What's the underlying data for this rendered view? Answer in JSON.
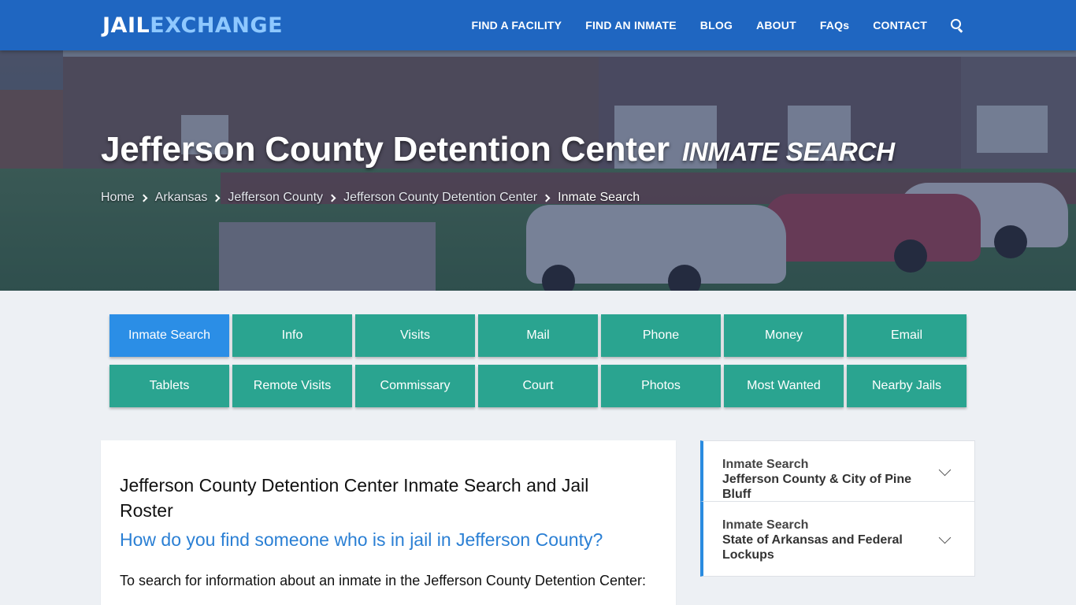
{
  "brand": {
    "logo_part1": "JAIL",
    "logo_part2": "EXCHANGE",
    "accent": "#1f66c1",
    "logo_accent": "#8ec8ff"
  },
  "nav": {
    "items": [
      "FIND A FACILITY",
      "FIND AN INMATE",
      "BLOG",
      "ABOUT",
      "FAQs",
      "CONTACT"
    ],
    "search_icon": "search-icon"
  },
  "hero": {
    "title": "Jefferson County Detention Center",
    "subtitle": "INMATE SEARCH",
    "breadcrumb": [
      "Home",
      "Arkansas",
      "Jefferson County",
      "Jefferson County Detention Center",
      "Inmate Search"
    ]
  },
  "tiles": {
    "row1": [
      "Inmate Search",
      "Info",
      "Visits",
      "Mail",
      "Phone",
      "Money",
      "Email"
    ],
    "row2": [
      "Tablets",
      "Remote Visits",
      "Commissary",
      "Court",
      "Photos",
      "Most Wanted",
      "Nearby Jails"
    ],
    "active": "Inmate Search",
    "color": "#2aa490",
    "active_color": "#2b8ee6"
  },
  "content": {
    "heading": "Jefferson County Detention Center Inmate Search and Jail Roster",
    "question": "How do you find someone who is in jail in Jefferson County?",
    "intro": "To search for information about an inmate in the Jefferson County Detention Center:"
  },
  "sidebar": {
    "items": [
      {
        "label": "Inmate Search",
        "sublabel": "Jefferson County & City of Pine Bluff"
      },
      {
        "label": "Inmate Search",
        "sublabel": "State of Arkansas and Federal Lockups"
      }
    ],
    "chevron_icon": "chevron-down-icon"
  }
}
